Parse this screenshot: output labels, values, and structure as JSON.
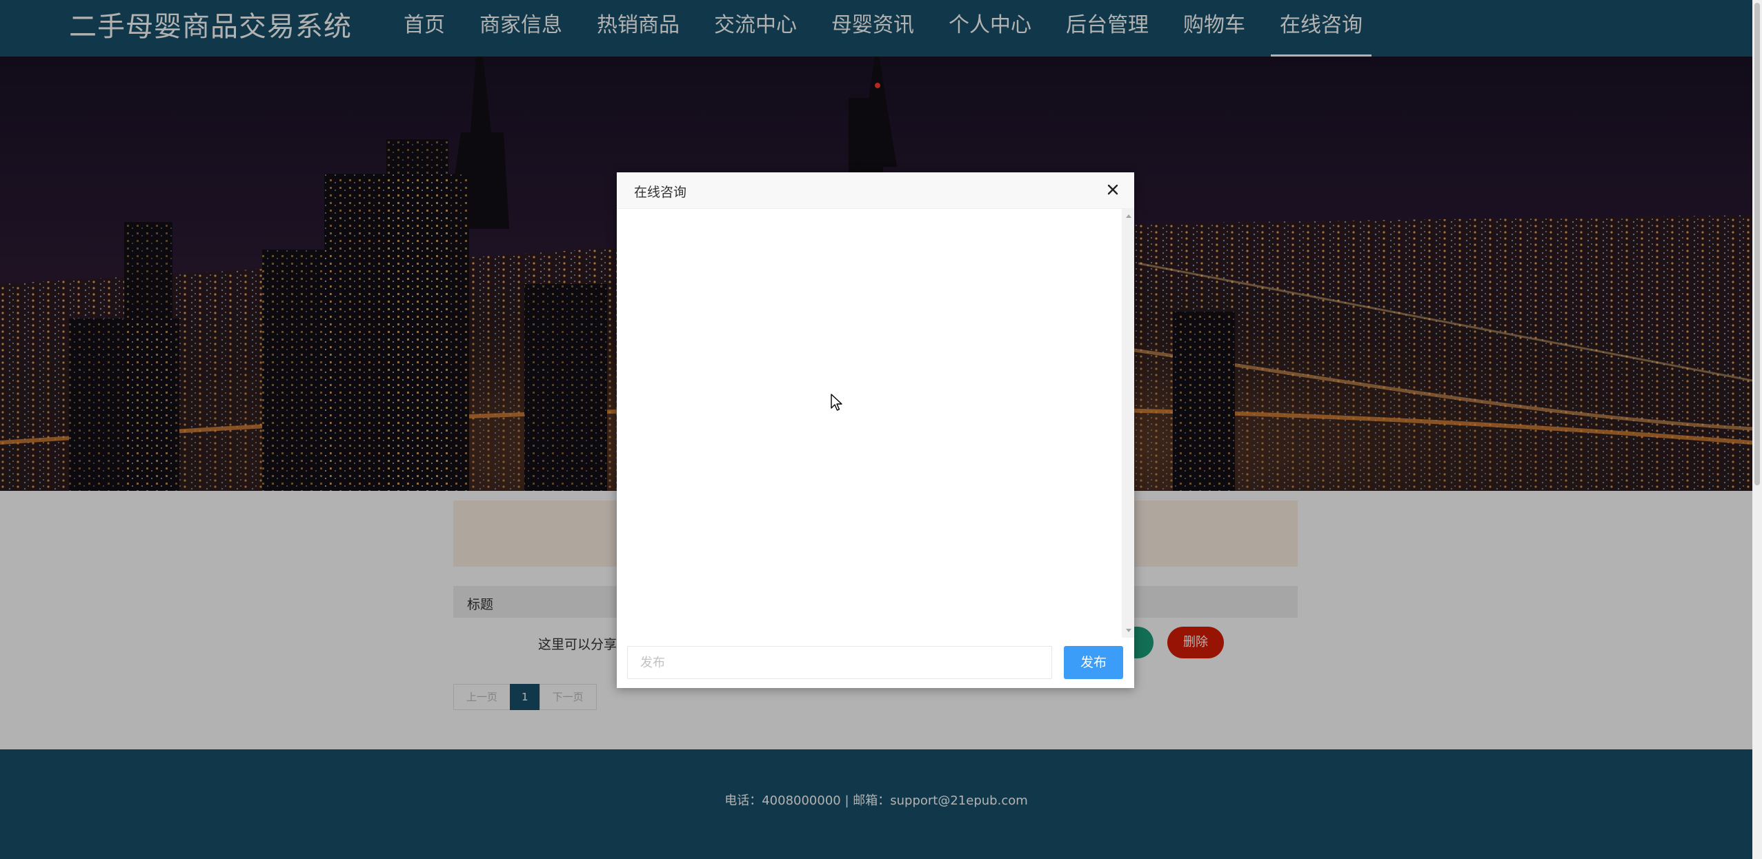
{
  "header": {
    "brand": "二手母婴商品交易系统",
    "nav": [
      {
        "label": "首页"
      },
      {
        "label": "商家信息"
      },
      {
        "label": "热销商品"
      },
      {
        "label": "交流中心"
      },
      {
        "label": "母婴资讯"
      },
      {
        "label": "个人中心"
      },
      {
        "label": "后台管理"
      },
      {
        "label": "购物车"
      },
      {
        "label": "在线咨询",
        "active": true
      }
    ]
  },
  "content": {
    "table_header": "标题",
    "row_text": "这里可以分享自",
    "green_button_label": "",
    "delete_button_label": "删除",
    "pager": {
      "prev": "上一页",
      "current": "1",
      "next": "下一页"
    }
  },
  "footer": {
    "contact": "电话：4008000000 | 邮箱：support@21epub.com"
  },
  "modal": {
    "title": "在线咨询",
    "input_placeholder": "发布",
    "input_value": "",
    "send_label": "发布"
  },
  "colors": {
    "header_bg": "#17506a",
    "send_button": "#3c9df8",
    "delete_button": "#d81e06",
    "green_button": "#1aa07a",
    "notice_bg": "#fbeee2"
  },
  "icons": [
    "close-icon",
    "scroll-up-arrow-icon",
    "scroll-down-arrow-icon",
    "mouse-cursor-icon"
  ]
}
